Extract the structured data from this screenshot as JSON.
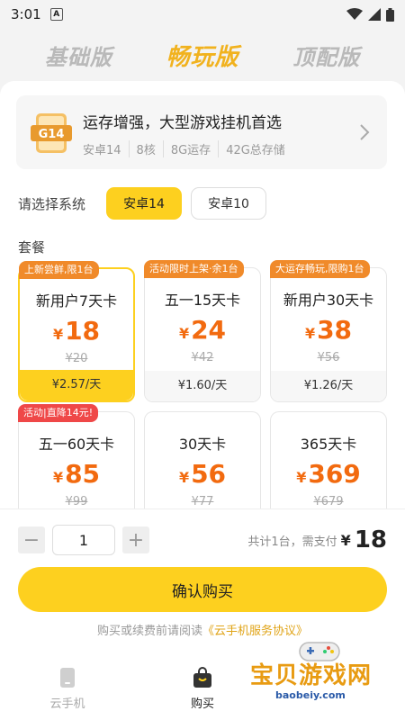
{
  "status": {
    "time": "3:01",
    "notif": "A"
  },
  "top_tabs": [
    {
      "label": "基础版"
    },
    {
      "label": "畅玩版"
    },
    {
      "label": "顶配版"
    }
  ],
  "device": {
    "badge": "G14",
    "title": "运存增强，大型游戏挂机首选",
    "specs": [
      "安卓14",
      "8核",
      "8G运存",
      "42G总存储"
    ]
  },
  "system": {
    "label": "请选择系统",
    "options": [
      "安卓14",
      "安卓10"
    ],
    "selected": "安卓14"
  },
  "packages_label": "套餐",
  "packages": [
    {
      "tag": "上新尝鲜,限1台",
      "name": "新用户7天卡",
      "currency": "¥",
      "price": "18",
      "orig": "¥20",
      "daily": "¥2.57/天"
    },
    {
      "tag": "活动限时上架·余1台",
      "name": "五一15天卡",
      "currency": "¥",
      "price": "24",
      "orig": "¥42",
      "daily": "¥1.60/天"
    },
    {
      "tag": "大运存畅玩,限购1台",
      "name": "新用户30天卡",
      "currency": "¥",
      "price": "38",
      "orig": "¥56",
      "daily": "¥1.26/天"
    },
    {
      "tag": "活动|直降14元!",
      "name": "五一60天卡",
      "currency": "¥",
      "price": "85",
      "orig": "¥99"
    },
    {
      "tag": "",
      "name": "30天卡",
      "currency": "¥",
      "price": "56",
      "orig": "¥77"
    },
    {
      "tag": "",
      "name": "365天卡",
      "currency": "¥",
      "price": "369",
      "orig": "¥679"
    }
  ],
  "quantity": {
    "minus": "−",
    "value": "1",
    "plus": "+"
  },
  "total": {
    "text": "共计1台，需支付",
    "currency": "¥",
    "amount": "18"
  },
  "confirm_label": "确认购买",
  "agreement": {
    "prefix": "购买或续费前请阅读",
    "link": "《云手机服务协议》"
  },
  "bottom_nav": [
    {
      "label": "云手机"
    },
    {
      "label": "购买"
    }
  ],
  "watermark": {
    "title": "宝贝游戏网",
    "sub": "baobeiy.com"
  },
  "colors": {
    "accent": "#fdd01f",
    "price": "#f26a0f",
    "tag": "#f08a2a",
    "tag_red": "#ef4848"
  }
}
